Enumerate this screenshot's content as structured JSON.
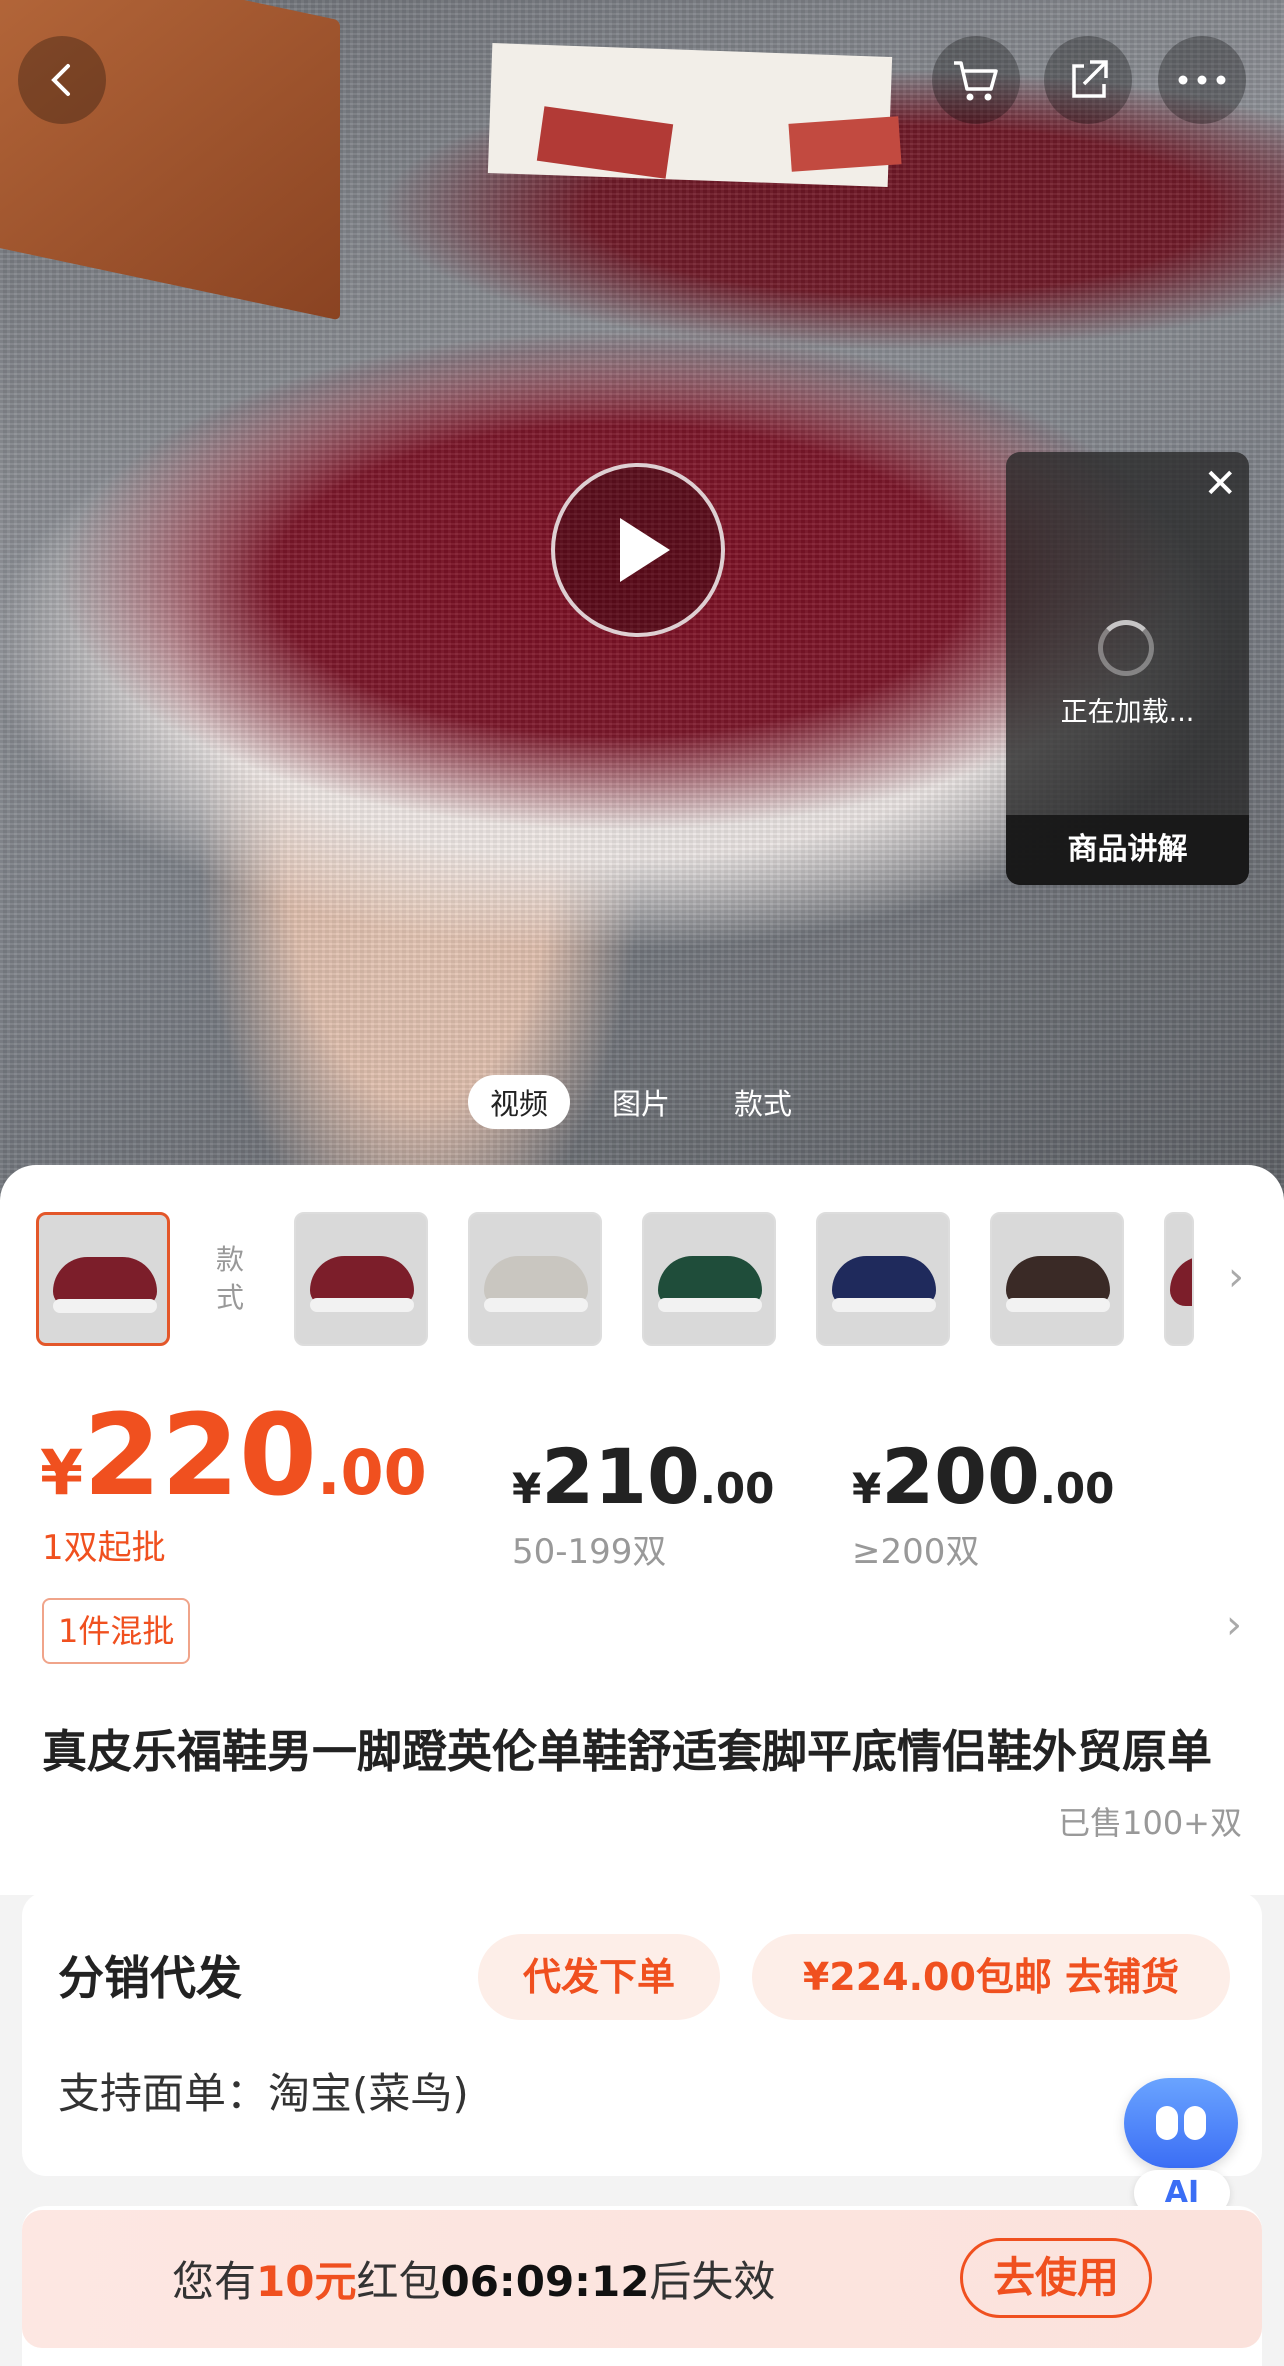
{
  "media": {
    "tabs": [
      {
        "label": "视频",
        "active": true
      },
      {
        "label": "图片",
        "active": false
      },
      {
        "label": "款式",
        "active": false
      }
    ],
    "live_panel": {
      "loading": "正在加载...",
      "label": "商品讲解"
    }
  },
  "styles": {
    "label": "款式",
    "thumbnails": [
      {
        "color": "#7c1e2a",
        "selected": true
      },
      {
        "color": "#7c1e2a"
      },
      {
        "color": "#c9c6c0"
      },
      {
        "color": "#1f4d3a"
      },
      {
        "color": "#1f2a5c"
      },
      {
        "color": "#3a2a26"
      },
      {
        "color": "#7c1e2a"
      }
    ]
  },
  "pricing": {
    "tiers": [
      {
        "currency": "¥",
        "integer": "220",
        "decimal": ".00",
        "qty": "1双起批"
      },
      {
        "currency": "¥",
        "integer": "210",
        "decimal": ".00",
        "qty": "50-199双"
      },
      {
        "currency": "¥",
        "integer": "200",
        "decimal": ".00",
        "qty": "≥200双"
      }
    ],
    "mix_tag": "1件混批"
  },
  "product": {
    "title": "真皮乐福鞋男一脚蹬英伦单鞋舒适套脚平底情侣鞋外贸原单",
    "sold": "已售100+双"
  },
  "distribution": {
    "title": "分销代发",
    "order_button": "代发下单",
    "stock_button": "¥224.00包邮 去铺货",
    "face_sheet": "支持面单：淘宝(菜鸟)"
  },
  "assistant": {
    "label": "AI"
  },
  "coupon": {
    "prefix": "您有",
    "amount": "10元",
    "kind": "红包",
    "countdown": "06:09:12",
    "suffix": "后失效",
    "button": "去使用"
  },
  "colors": {
    "accent": "#f0501f",
    "assistant": "#3b6ef5"
  }
}
